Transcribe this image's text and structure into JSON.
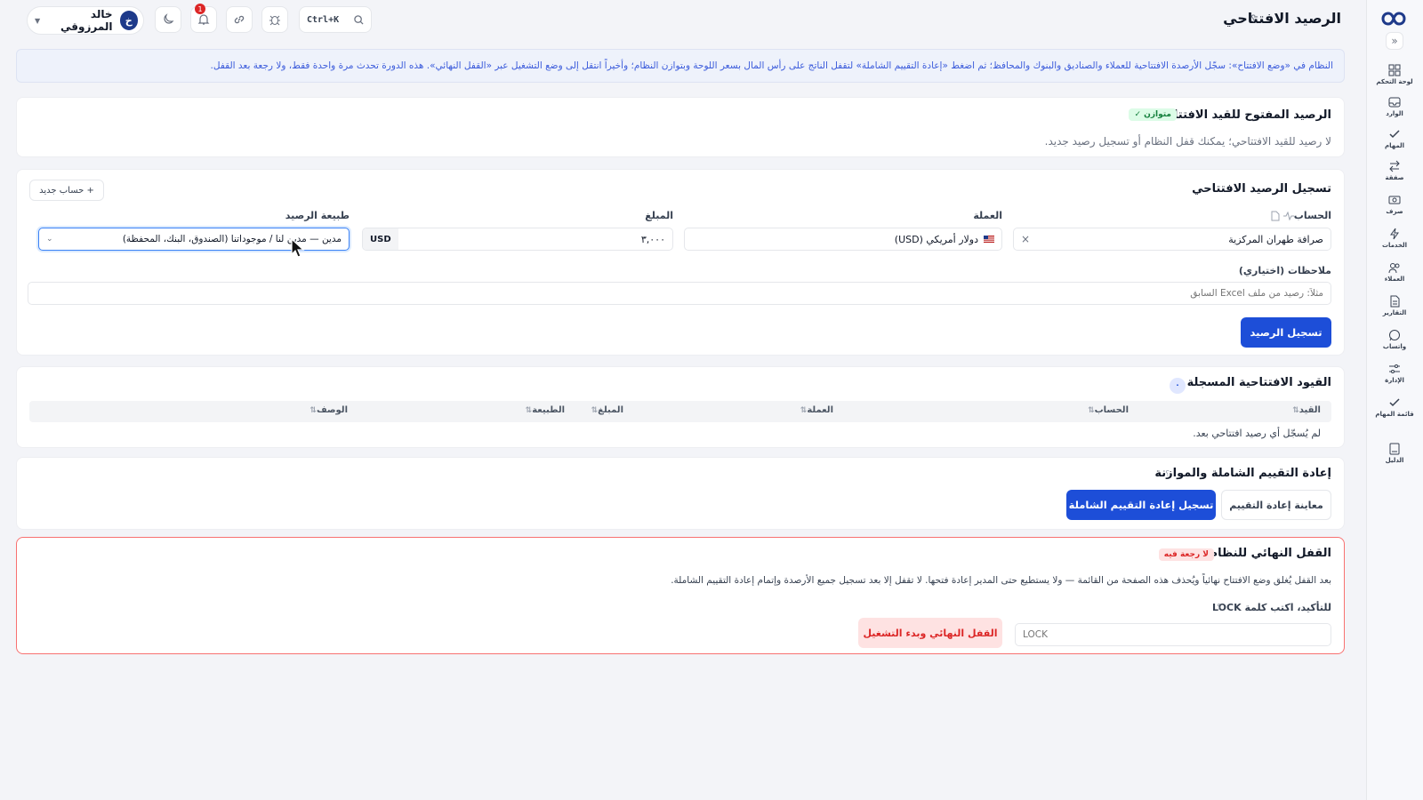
{
  "app": {
    "page_title": "الرصيد الافتتاحي",
    "help_glyph": "؟"
  },
  "topbar": {
    "user": {
      "name": "خالد المرزوقي",
      "initial": "خ"
    },
    "notifications_count": "1",
    "search_shortcut": "Ctrl+K"
  },
  "sidebar": {
    "items": [
      {
        "label": "لوحة التحكم",
        "icon": "dashboard-icon"
      },
      {
        "label": "الوارد",
        "icon": "inbox-icon"
      },
      {
        "label": "المهام",
        "icon": "check-icon"
      },
      {
        "label": "صفقة",
        "icon": "swap-icon"
      },
      {
        "label": "صرف",
        "icon": "cash-icon"
      },
      {
        "label": "الخدمات",
        "icon": "bolt-icon"
      },
      {
        "label": "العملاء",
        "icon": "users-icon"
      },
      {
        "label": "التقارير",
        "icon": "report-icon"
      },
      {
        "label": "واتساب",
        "icon": "chat-icon"
      },
      {
        "label": "الإدارة",
        "icon": "sliders-icon"
      },
      {
        "label": "قائمة المهام",
        "icon": "checklist-icon"
      },
      {
        "label": "الدليل",
        "icon": "book-icon"
      }
    ]
  },
  "banner": {
    "text": "النظام في «وضع الافتتاح»: سجّل الأرصدة الافتتاحية للعملاء والصناديق والبنوك والمحافظ؛ ثم اضغط «إعادة التقييم الشاملة» لتقفل الناتج على رأس المال بسعر اللوحة وبتوازن النظام؛ وأخيراً انتقل إلى وضع التشغيل عبر «القفل النهائي». هذه الدورة تحدث مرة واحدة فقط، ولا رجعة بعد القفل."
  },
  "open_balance": {
    "title": "الرصيد المفتوح للقيد الافتتاحي",
    "status_badge": "متوازن ✓",
    "message": "لا رصيد للقيد الافتتاحي؛ يمكنك قفل النظام أو تسجيل رصيد جديد."
  },
  "register": {
    "title": "تسجيل الرصيد الافتتاحي",
    "new_account_button": "+ حساب جديد",
    "account_label": "الحساب",
    "account_value": "صرافة طهران المركزية",
    "currency_label": "العملة",
    "currency_value": "دولار أمريكي (USD)",
    "amount_label": "المبلغ",
    "amount_value": "٣,٠٠٠",
    "amount_currency": "USD",
    "nature_label": "طبيعة الرصيد",
    "nature_value": "مدين — مدين لنا / موجوداتنا (الصندوق، البنك، المحفظة)",
    "notes_label": "ملاحظات (اختياري)",
    "notes_placeholder": "مثلاً: رصيد من ملف Excel السابق",
    "submit_button": "تسجيل الرصيد"
  },
  "entries": {
    "title": "القيود الافتتاحية المسجلة",
    "count": "٠",
    "columns": [
      "القيد",
      "الحساب",
      "العملة",
      "المبلغ",
      "الطبيعة",
      "الوصف"
    ],
    "empty_message": "لم يُسجّل أي رصيد افتتاحي بعد."
  },
  "revaluation": {
    "title": "إعادة التقييم الشاملة والموازنة",
    "register_button": "تسجيل إعادة التقييم الشاملة",
    "preview_button": "معاينة إعادة التقييم"
  },
  "final_lock": {
    "title": "القفل النهائي للنظام",
    "warning_badge": "لا رجعة فيه",
    "description": "بعد القفل يُغلق وضع الافتتاح نهائياً ويُحذف هذه الصفحة من القائمة — ولا يستطيع حتى المدير إعادة فتحها. لا تقفل إلا بعد تسجيل جميع الأرصدة وإتمام إعادة التقييم الشاملة.",
    "confirm_label": "للتأكيد، اكتب كلمة LOCK",
    "confirm_placeholder": "LOCK",
    "lock_button": "القفل النهائي وبدء التشغيل"
  },
  "colors": {
    "primary": "#1d4ed8",
    "danger": "#dc2626",
    "success": "#15803d",
    "banner_text": "#3b5bdb"
  }
}
